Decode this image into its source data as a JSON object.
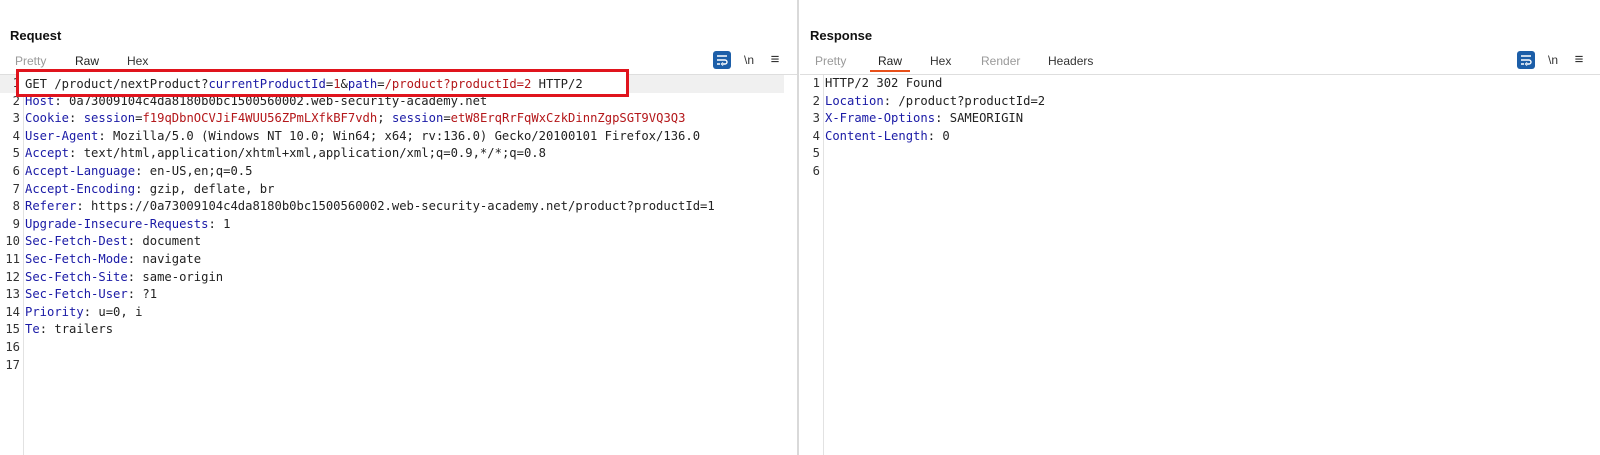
{
  "request": {
    "title": "Request",
    "tabs": [
      "Pretty",
      "Raw",
      "Hex"
    ],
    "active_tab": "Raw",
    "tool_newline": "\\n",
    "tool_menu": "≡",
    "lines": [
      {
        "n": "1",
        "parts": [
          [
            "t",
            "GET /product/nextProduct?"
          ],
          [
            "k",
            "currentProductId"
          ],
          [
            "t",
            "="
          ],
          [
            "v",
            "1"
          ],
          [
            "t",
            "&"
          ],
          [
            "k",
            "path"
          ],
          [
            "t",
            "="
          ],
          [
            "v",
            "/product?productId=2"
          ],
          [
            "t",
            " HTTP/2"
          ]
        ]
      },
      {
        "n": "2",
        "parts": [
          [
            "k",
            "Host"
          ],
          [
            "t",
            ": 0a73009104c4da8180b0bc1500560002.web-security-academy.net"
          ]
        ]
      },
      {
        "n": "3",
        "parts": [
          [
            "k",
            "Cookie"
          ],
          [
            "t",
            ": "
          ],
          [
            "k",
            "session"
          ],
          [
            "t",
            "="
          ],
          [
            "v",
            "f19qDbnOCVJiF4WUU56ZPmLXfkBF7vdh"
          ],
          [
            "t",
            "; "
          ],
          [
            "k",
            "session"
          ],
          [
            "t",
            "="
          ],
          [
            "v",
            "etW8ErqRrFqWxCzkDinnZgpSGT9VQ3Q3"
          ]
        ]
      },
      {
        "n": "4",
        "parts": [
          [
            "k",
            "User-Agent"
          ],
          [
            "t",
            ": Mozilla/5.0 (Windows NT 10.0; Win64; x64; rv:136.0) Gecko/20100101 Firefox/136.0"
          ]
        ]
      },
      {
        "n": "5",
        "parts": [
          [
            "k",
            "Accept"
          ],
          [
            "t",
            ": text/html,application/xhtml+xml,application/xml;q=0.9,*/*;q=0.8"
          ]
        ]
      },
      {
        "n": "6",
        "parts": [
          [
            "k",
            "Accept-Language"
          ],
          [
            "t",
            ": en-US,en;q=0.5"
          ]
        ]
      },
      {
        "n": "7",
        "parts": [
          [
            "k",
            "Accept-Encoding"
          ],
          [
            "t",
            ": gzip, deflate, br"
          ]
        ]
      },
      {
        "n": "8",
        "parts": [
          [
            "k",
            "Referer"
          ],
          [
            "t",
            ": https://0a73009104c4da8180b0bc1500560002.web-security-academy.net/product?productId=1"
          ]
        ]
      },
      {
        "n": "9",
        "parts": [
          [
            "k",
            "Upgrade-Insecure-Requests"
          ],
          [
            "t",
            ": 1"
          ]
        ]
      },
      {
        "n": "10",
        "parts": [
          [
            "k",
            "Sec-Fetch-Dest"
          ],
          [
            "t",
            ": document"
          ]
        ]
      },
      {
        "n": "11",
        "parts": [
          [
            "k",
            "Sec-Fetch-Mode"
          ],
          [
            "t",
            ": navigate"
          ]
        ]
      },
      {
        "n": "12",
        "parts": [
          [
            "k",
            "Sec-Fetch-Site"
          ],
          [
            "t",
            ": same-origin"
          ]
        ]
      },
      {
        "n": "13",
        "parts": [
          [
            "k",
            "Sec-Fetch-User"
          ],
          [
            "t",
            ": ?1"
          ]
        ]
      },
      {
        "n": "14",
        "parts": [
          [
            "k",
            "Priority"
          ],
          [
            "t",
            ": u=0, i"
          ]
        ]
      },
      {
        "n": "15",
        "parts": [
          [
            "k",
            "Te"
          ],
          [
            "t",
            ": trailers"
          ]
        ]
      },
      {
        "n": "16",
        "parts": []
      },
      {
        "n": "17",
        "parts": []
      }
    ]
  },
  "response": {
    "title": "Response",
    "tabs": [
      "Pretty",
      "Raw",
      "Hex",
      "Render",
      "Headers"
    ],
    "active_tab": "Raw",
    "tool_newline": "\\n",
    "tool_menu": "≡",
    "lines": [
      {
        "n": "1",
        "parts": [
          [
            "t",
            "HTTP/2 302 Found"
          ]
        ]
      },
      {
        "n": "2",
        "parts": [
          [
            "k",
            "Location"
          ],
          [
            "t",
            ": /product?productId=2"
          ]
        ]
      },
      {
        "n": "3",
        "parts": [
          [
            "k",
            "X-Frame-Options"
          ],
          [
            "t",
            ": SAMEORIGIN"
          ]
        ]
      },
      {
        "n": "4",
        "parts": [
          [
            "k",
            "Content-Length"
          ],
          [
            "t",
            ": 0"
          ]
        ]
      },
      {
        "n": "5",
        "parts": []
      },
      {
        "n": "6",
        "parts": []
      }
    ]
  },
  "colors": {
    "accent": "#e8501a",
    "highlight_box": "#e0141d",
    "key": "#1a1aa6",
    "value": "#b4171a",
    "button_blue": "#1c5ea8"
  },
  "icons": {
    "wrap": "word-wrap-icon",
    "menu": "hamburger-menu-icon",
    "layout": [
      "side-by-side-layout-icon",
      "top-bottom-layout-icon",
      "single-pane-layout-icon"
    ]
  }
}
